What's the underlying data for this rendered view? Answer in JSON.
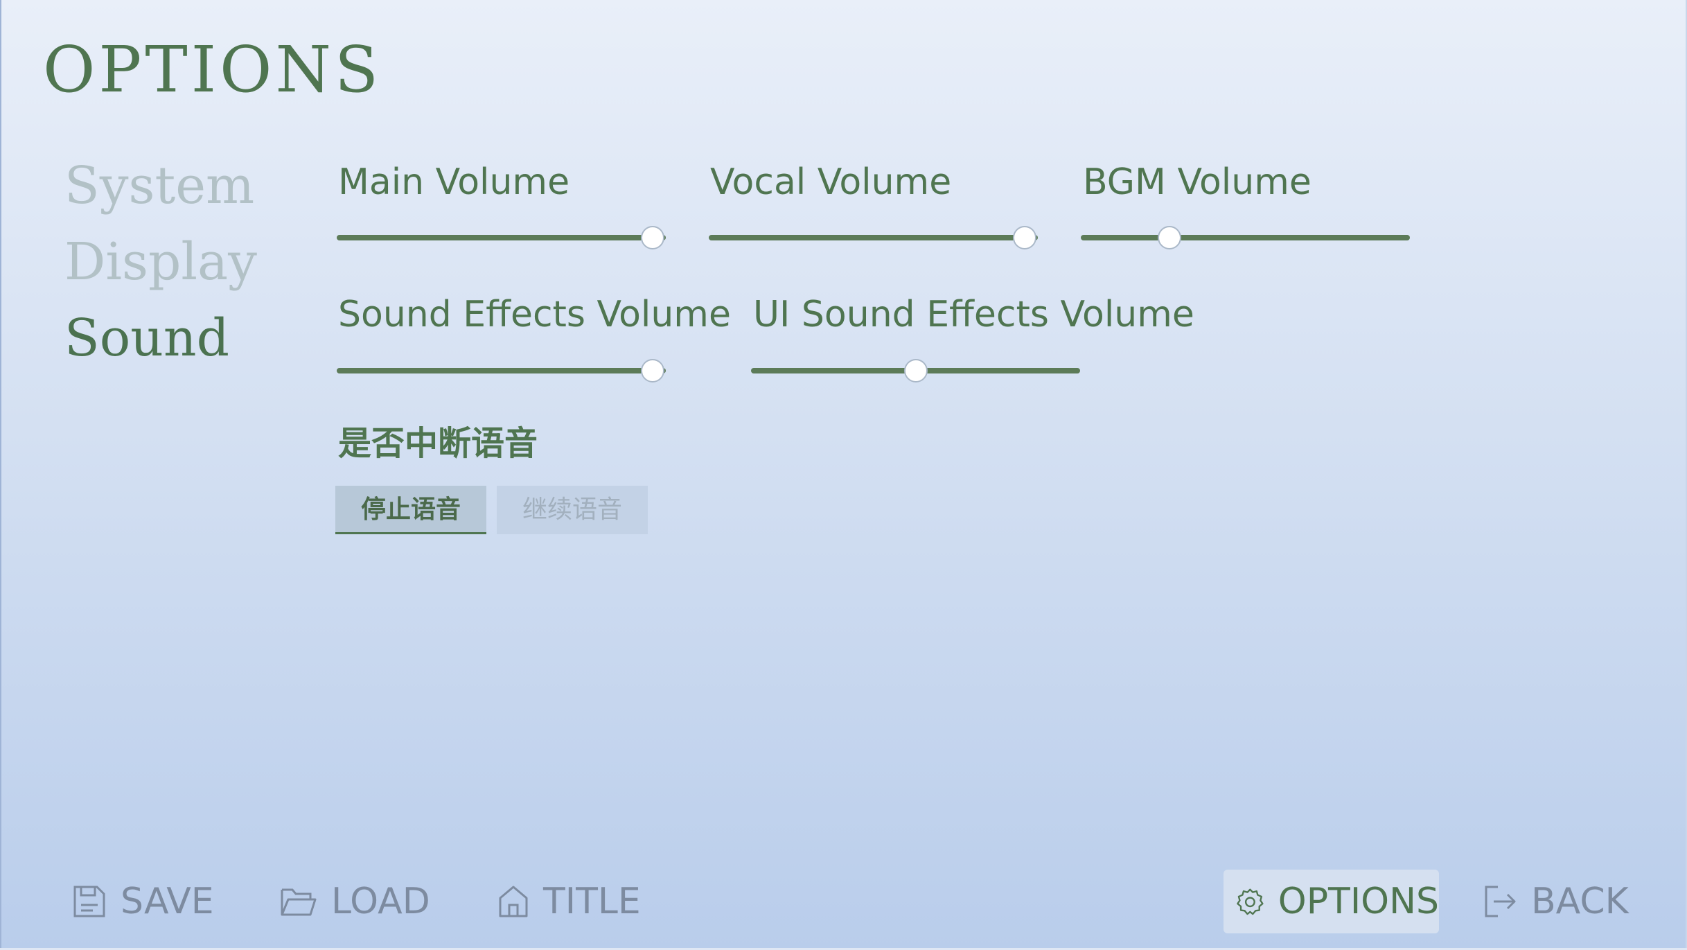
{
  "screen": {
    "title": "OPTIONS"
  },
  "sidebar": {
    "items": [
      {
        "label": "System",
        "state": "inactive"
      },
      {
        "label": "Display",
        "state": "inactive"
      },
      {
        "label": "Sound",
        "state": "active"
      }
    ]
  },
  "sound": {
    "sliders": [
      {
        "label": "Main Volume",
        "level": 0.96
      },
      {
        "label": "Vocal Volume",
        "level": 0.96
      },
      {
        "label": "BGM Volume",
        "level": 0.27
      },
      {
        "label": "Sound Effects Volume",
        "level": 0.96
      },
      {
        "label": "UI Sound Effects Volume",
        "level": 0.5
      }
    ],
    "interrupt_voice": {
      "heading": "是否中断语音",
      "options": [
        {
          "label": "停止语音",
          "selected": true
        },
        {
          "label": "继续语音",
          "selected": false
        }
      ]
    }
  },
  "bottom_nav": {
    "save": "SAVE",
    "load": "LOAD",
    "title": "TITLE",
    "options": "OPTIONS",
    "back": "BACK"
  },
  "colors": {
    "accent": "#4f7550",
    "inactive_text": "#b2c1c6",
    "nav_text": "#7d8ba0",
    "track": "#5c7b58"
  }
}
